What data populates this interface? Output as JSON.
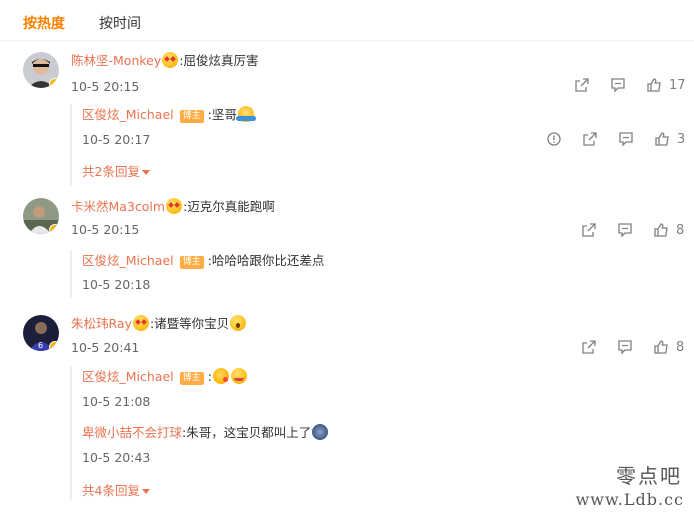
{
  "tabs": [
    {
      "label": "按热度",
      "active": true
    },
    {
      "label": "按时间",
      "active": false
    }
  ],
  "badge_label": "博主",
  "comments": [
    {
      "author": "陈林坚-Monkey",
      "text": ":屈俊炫真厉害",
      "time": "10-5 20:15",
      "likes": "17",
      "replies": [
        {
          "author": "区俊炫_Michael",
          "text": ":坚哥",
          "time": "10-5 20:17",
          "likes": "3"
        }
      ],
      "more": "共2条回复"
    },
    {
      "author": "卡米然Ma3colm",
      "text": ":迈克尔真能跑啊",
      "time": "10-5 20:15",
      "likes": "8",
      "replies": [
        {
          "author": "区俊炫_Michael",
          "text": ":哈哈哈跟你比还差点",
          "time": "10-5 20:18"
        }
      ]
    },
    {
      "author": "朱松玮Ray",
      "text": ":诸暨等你宝贝",
      "time": "10-5 20:41",
      "likes": "8",
      "replies": [
        {
          "author": "区俊炫_Michael",
          "text": ":",
          "time": "10-5 21:08"
        },
        {
          "author": "卑微小喆不会打球",
          "text": ":朱哥，这宝贝都叫上了",
          "time": "10-5 20:43"
        }
      ],
      "more": "共4条回复"
    }
  ],
  "watermark": {
    "line1": "零点吧",
    "line2": "www.Ldb.cc"
  },
  "colors": {
    "accent": "#ff8200",
    "name": "#eb7350",
    "badge": "#ffac44",
    "verified": "#f7b500"
  }
}
